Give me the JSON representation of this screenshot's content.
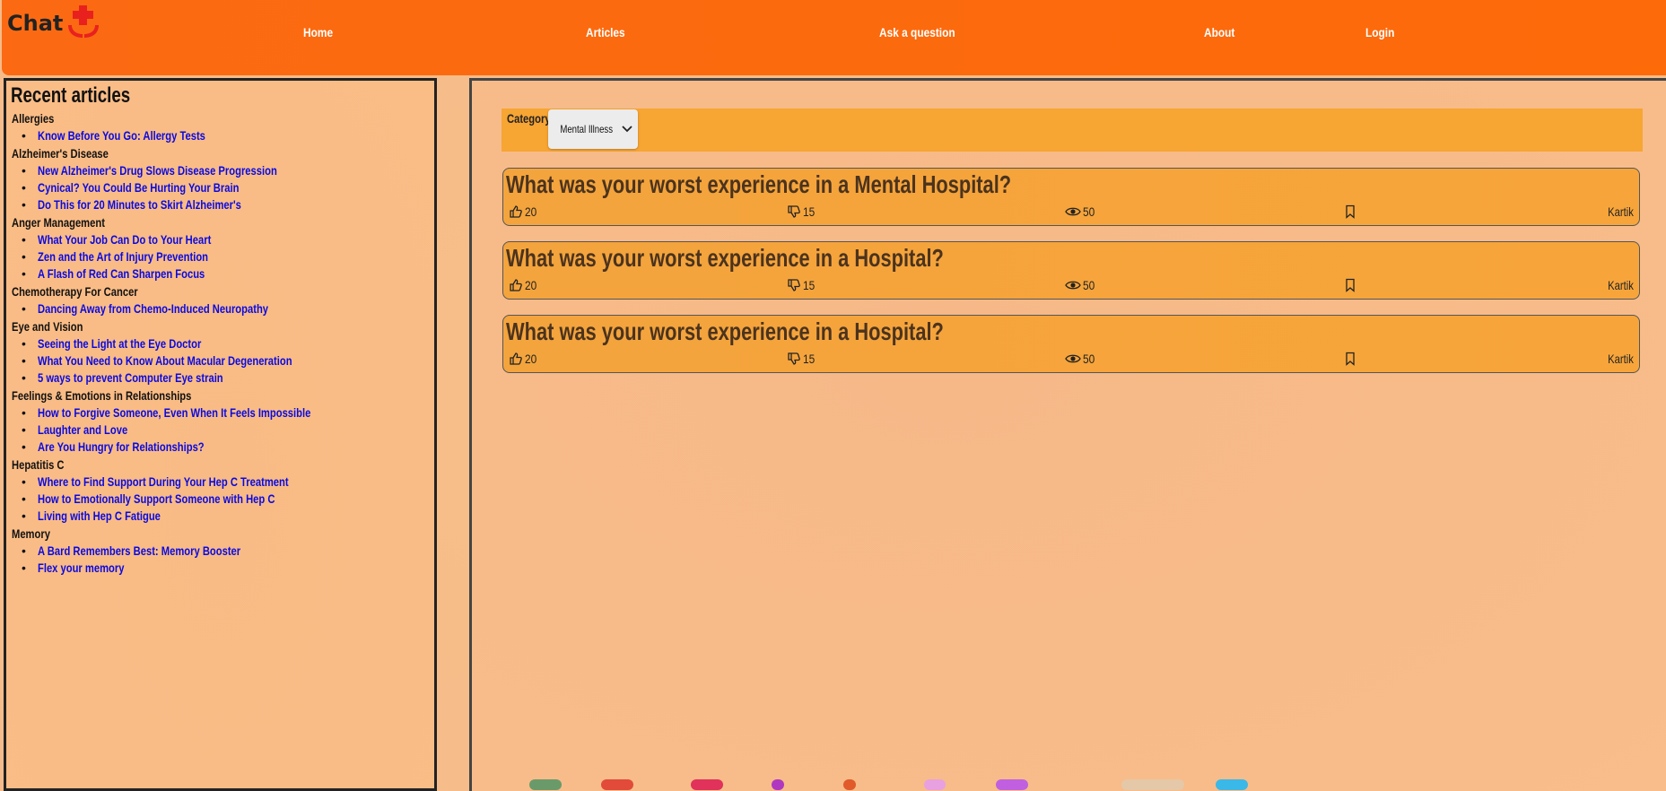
{
  "header": {
    "logo_text": "Chat",
    "nav": [
      "Home",
      "Articles",
      "Ask a question",
      "About",
      "Login"
    ]
  },
  "sidebar": {
    "title": "Recent articles",
    "categories": [
      {
        "name": "Allergies",
        "articles": [
          "Know Before You Go: Allergy Tests"
        ]
      },
      {
        "name": "Alzheimer's Disease",
        "articles": [
          "New Alzheimer's Drug Slows Disease Progression",
          "Cynical? You Could Be Hurting Your Brain",
          "Do This for 20 Minutes to Skirt Alzheimer's"
        ]
      },
      {
        "name": "Anger Management",
        "articles": [
          "What Your Job Can Do to Your Heart",
          "Zen and the Art of Injury Prevention",
          "A Flash of Red Can Sharpen Focus"
        ]
      },
      {
        "name": "Chemotherapy For Cancer",
        "articles": [
          "Dancing Away from Chemo-Induced Neuropathy"
        ]
      },
      {
        "name": "Eye and Vision",
        "articles": [
          "Seeing the Light at the Eye Doctor",
          "What You Need to Know About Macular Degeneration",
          "5 ways to prevent Computer Eye strain"
        ]
      },
      {
        "name": "Feelings & Emotions in Relationships",
        "articles": [
          "How to Forgive Someone, Even When It Feels Impossible",
          "Laughter and Love",
          "Are You Hungry for Relationships?"
        ]
      },
      {
        "name": "Hepatitis C",
        "articles": [
          "Where to Find Support During Your Hep C Treatment",
          "How to Emotionally Support Someone with Hep C",
          "Living with Hep C Fatigue"
        ]
      },
      {
        "name": "Memory",
        "articles": [
          "A Bard Remembers Best: Memory Booster",
          "Flex your memory"
        ]
      }
    ]
  },
  "filter": {
    "label": "Category",
    "selected": "Mental Illness"
  },
  "questions": [
    {
      "title": "What was your worst experience in a Mental Hospital?",
      "likes": "20",
      "dislikes": "15",
      "views": "50",
      "author": "Kartik"
    },
    {
      "title": "What was your worst experience in a Hospital?",
      "likes": "20",
      "dislikes": "15",
      "views": "50",
      "author": "Kartik"
    },
    {
      "title": "What was your worst experience in a Hospital?",
      "likes": "20",
      "dislikes": "15",
      "views": "50",
      "author": "Kartik"
    }
  ],
  "colors": {
    "header": "#fd6a0a",
    "link": "#0a0ae0",
    "card": "#f7a53a",
    "logo_cross": "#e8211e"
  },
  "icons": [
    "thumbs-up-icon",
    "thumbs-down-icon",
    "eye-icon",
    "bookmark-icon",
    "chevron-down-icon",
    "medical-cross-hands-icon"
  ]
}
